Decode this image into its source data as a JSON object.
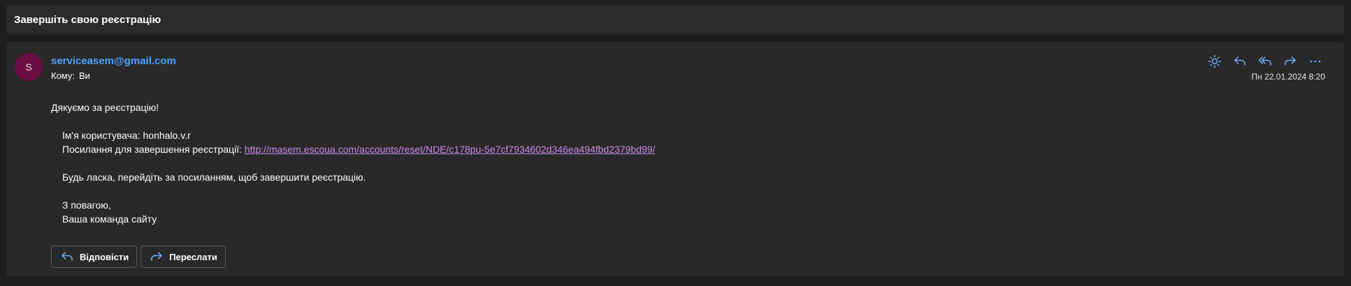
{
  "subject": "Завершіть свою реєстрацію",
  "message": {
    "avatar_initial": "S",
    "sender": "serviceasem@gmail.com",
    "to_label": "Кому:",
    "to_value": "Ви",
    "date": "Пн 22.01.2024 8:20",
    "body": {
      "greeting": "Дякуємо за реєстрацію!",
      "username_line": "Ім'я користувача: honhalo.v.r",
      "link_label": "Посилання для завершення реєстрації:",
      "link_url": "http://masem.escoua.com/accounts/reset/NDE/c178pu-5e7cf7934602d346ea494fbd2379bd99/",
      "instruction": "Будь ласка, перейдіть за посиланням, щоб завершити реєстрацію.",
      "regards": "З повагою,",
      "signature": "Ваша команда сайту"
    }
  },
  "buttons": {
    "reply": "Відповісти",
    "forward": "Переслати"
  },
  "icons": {
    "theme": "sun-icon",
    "reply": "reply-icon",
    "reply_all": "reply-all-icon",
    "forward": "forward-icon",
    "more": "more-icon"
  },
  "colors": {
    "accent": "#4ea1ff",
    "link": "#c98ce6",
    "avatar": "#6b0e43"
  }
}
